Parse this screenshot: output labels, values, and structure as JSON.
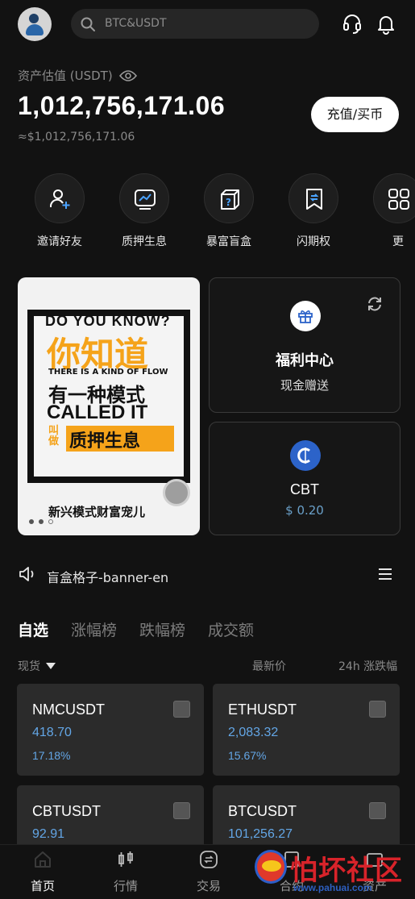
{
  "search": {
    "placeholder": "BTC&USDT"
  },
  "assets": {
    "label": "资产估值 (USDT)",
    "value": "1,012,756,171.06",
    "approx": "≈$1,012,756,171.06",
    "deposit_button": "充值/买币"
  },
  "quick_actions": [
    {
      "label": "邀请好友",
      "icon": "invite-user-icon"
    },
    {
      "label": "质押生息",
      "icon": "staking-chart-icon"
    },
    {
      "label": "暴富盲盒",
      "icon": "mystery-box-icon"
    },
    {
      "label": "闪期权",
      "icon": "flash-option-icon"
    },
    {
      "label": "更",
      "icon": "more-grid-icon"
    }
  ],
  "banner": {
    "line1": "DO YOU KNOW?",
    "line2": "你知道",
    "line3": "THERE IS A KIND OF FLOW",
    "line4": "有一种模式",
    "line5": "CALLED IT",
    "line6": "叫做",
    "line7": "质押生息",
    "line8": "新兴模式财富宠儿"
  },
  "welfare_card": {
    "title": "福利中心",
    "subtitle": "现金赠送"
  },
  "cbt_card": {
    "title": "CBT",
    "price": "$ 0.20"
  },
  "notice": {
    "text": "盲盒格子-banner-en"
  },
  "market_tabs": [
    "自选",
    "涨幅榜",
    "跌幅榜",
    "成交额"
  ],
  "columns": {
    "spot": "现货",
    "latest": "最新价",
    "change": "24h 涨跌幅"
  },
  "markets": [
    {
      "symbol": "NMCUSDT",
      "price": "418.70",
      "change": "17.18%"
    },
    {
      "symbol": "ETHUSDT",
      "price": "2,083.32",
      "change": "15.67%"
    },
    {
      "symbol": "CBTUSDT",
      "price": "92.91",
      "change": ""
    },
    {
      "symbol": "BTCUSDT",
      "price": "101,256.27",
      "change": ""
    }
  ],
  "bottom_nav": [
    {
      "label": "首页"
    },
    {
      "label": "行情"
    },
    {
      "label": "交易"
    },
    {
      "label": "合约"
    },
    {
      "label": "资产"
    }
  ],
  "watermark": {
    "text": "怕坏社区",
    "url": "www.pahuai.com"
  },
  "colors": {
    "accent_blue": "#63a6e6",
    "background": "#121212",
    "banner_orange": "#f5a31a"
  }
}
